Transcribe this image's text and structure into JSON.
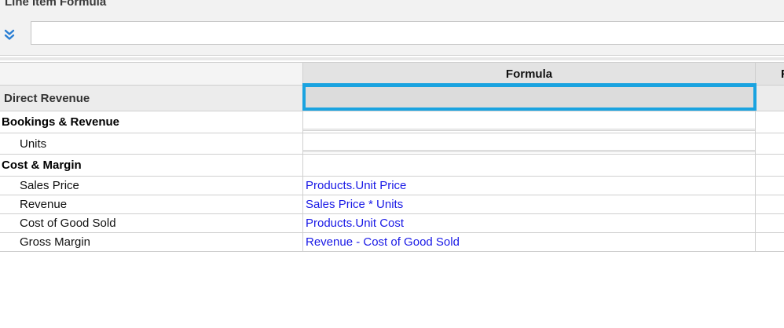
{
  "panel": {
    "title": "Line Item Formula",
    "expand_icon": "double-chevron-down-icon",
    "formula_input_value": "",
    "accent_color": "#1aa3e0"
  },
  "grid": {
    "columns": [
      "",
      "Formula",
      "F"
    ],
    "rows": [
      {
        "name": "Direct Revenue",
        "formula": "",
        "kind": "parent"
      },
      {
        "name": "Bookings & Revenue",
        "formula": "",
        "kind": "section"
      },
      {
        "name": "Units",
        "formula": "",
        "kind": "item"
      },
      {
        "name": "Cost & Margin",
        "formula": "",
        "kind": "section"
      },
      {
        "name": "Sales Price",
        "formula": "Products.Unit Price",
        "kind": "item"
      },
      {
        "name": "Revenue",
        "formula": "Sales Price * Units",
        "kind": "item"
      },
      {
        "name": "Cost of Good Sold",
        "formula": "Products.Unit Cost",
        "kind": "item"
      },
      {
        "name": "Gross Margin",
        "formula": "Revenue - Cost of Good Sold",
        "kind": "item"
      }
    ],
    "formula_color": "#1a1ae6"
  }
}
